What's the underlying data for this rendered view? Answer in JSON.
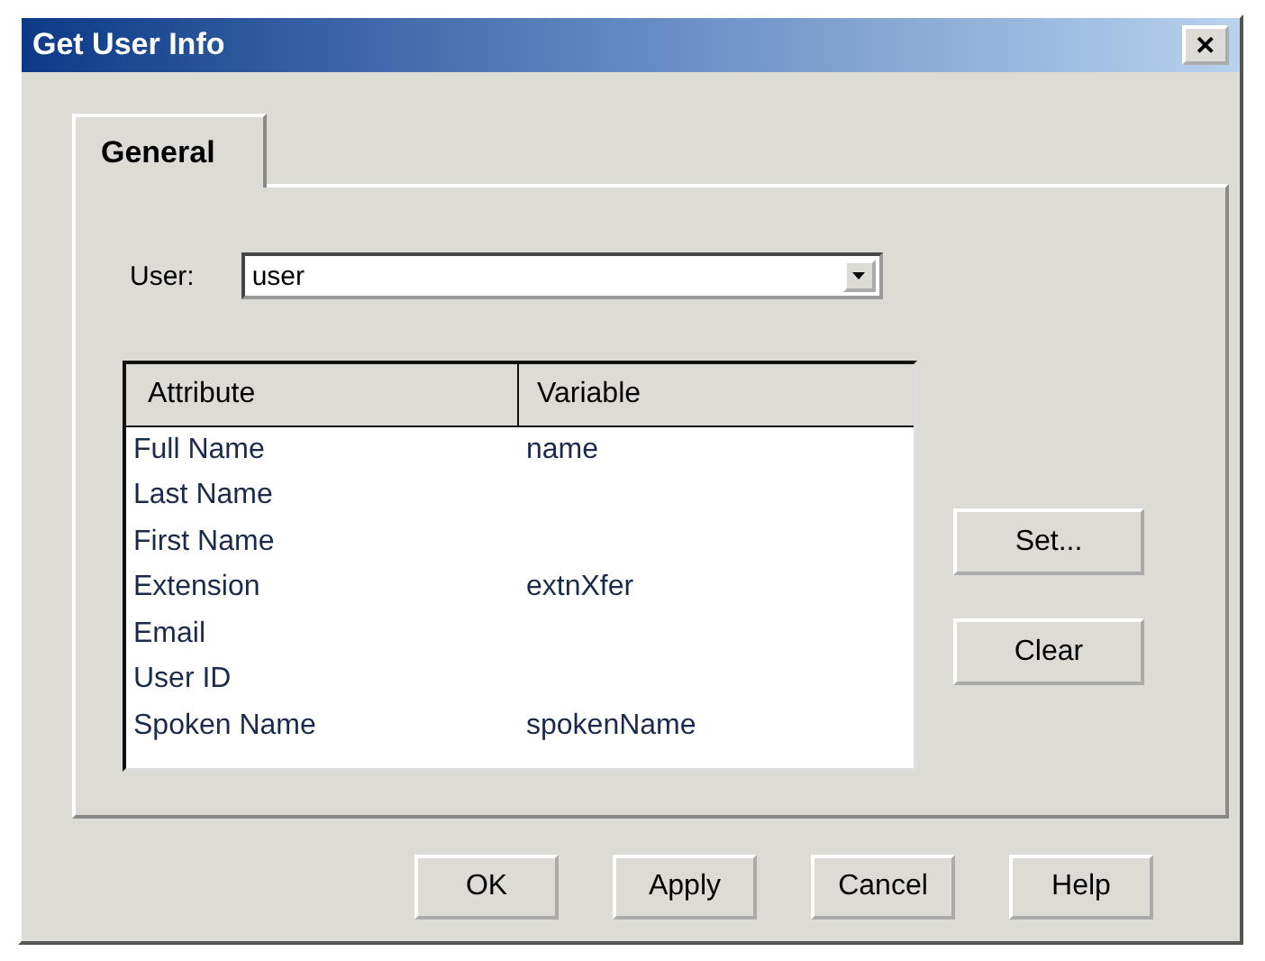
{
  "window": {
    "title": "Get User Info",
    "close": "✕"
  },
  "tabs": [
    {
      "label": "General",
      "selected": true
    }
  ],
  "user": {
    "label": "User:",
    "value": "user"
  },
  "table": {
    "columns": [
      "Attribute",
      "Variable"
    ],
    "rows": [
      {
        "attribute": "Full Name",
        "variable": "name"
      },
      {
        "attribute": "Last Name",
        "variable": ""
      },
      {
        "attribute": "First Name",
        "variable": ""
      },
      {
        "attribute": "Extension",
        "variable": "extnXfer"
      },
      {
        "attribute": "Email",
        "variable": ""
      },
      {
        "attribute": "User ID",
        "variable": ""
      },
      {
        "attribute": "Spoken Name",
        "variable": "spokenName"
      }
    ]
  },
  "side_buttons": [
    "Set...",
    "Clear"
  ],
  "buttons": [
    "OK",
    "Apply",
    "Cancel",
    "Help"
  ]
}
